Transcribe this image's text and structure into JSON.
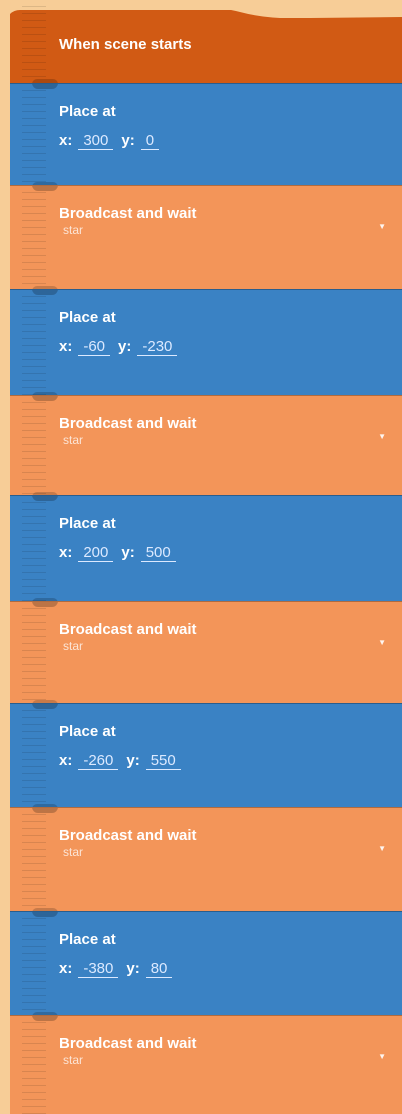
{
  "colors": {
    "background": "#f7cd97",
    "hat_block": "#d15a14",
    "place_block": "#3a82c4",
    "broadcast_block": "#f39559"
  },
  "blocks": [
    {
      "type": "hat",
      "title": "When scene starts"
    },
    {
      "type": "place",
      "title": "Place at",
      "x_label": "x:",
      "x": "300",
      "y_label": "y:",
      "y": "0"
    },
    {
      "type": "broadcast",
      "title": "Broadcast and wait",
      "message": "star",
      "caret_icon": "dropdown-triangle"
    },
    {
      "type": "place",
      "title": "Place at",
      "x_label": "x:",
      "x": "-60",
      "y_label": "y:",
      "y": "-230"
    },
    {
      "type": "broadcast",
      "title": "Broadcast and wait",
      "message": "star",
      "caret_icon": "dropdown-triangle"
    },
    {
      "type": "place",
      "title": "Place at",
      "x_label": "x:",
      "x": "200",
      "y_label": "y:",
      "y": "500"
    },
    {
      "type": "broadcast",
      "title": "Broadcast and wait",
      "message": "star",
      "caret_icon": "dropdown-triangle"
    },
    {
      "type": "place",
      "title": "Place at",
      "x_label": "x:",
      "x": "-260",
      "y_label": "y:",
      "y": "550"
    },
    {
      "type": "broadcast",
      "title": "Broadcast and wait",
      "message": "star",
      "caret_icon": "dropdown-triangle"
    },
    {
      "type": "place",
      "title": "Place at",
      "x_label": "x:",
      "x": "-380",
      "y_label": "y:",
      "y": "80"
    },
    {
      "type": "broadcast",
      "title": "Broadcast and wait",
      "message": "star",
      "caret_icon": "dropdown-triangle"
    }
  ]
}
